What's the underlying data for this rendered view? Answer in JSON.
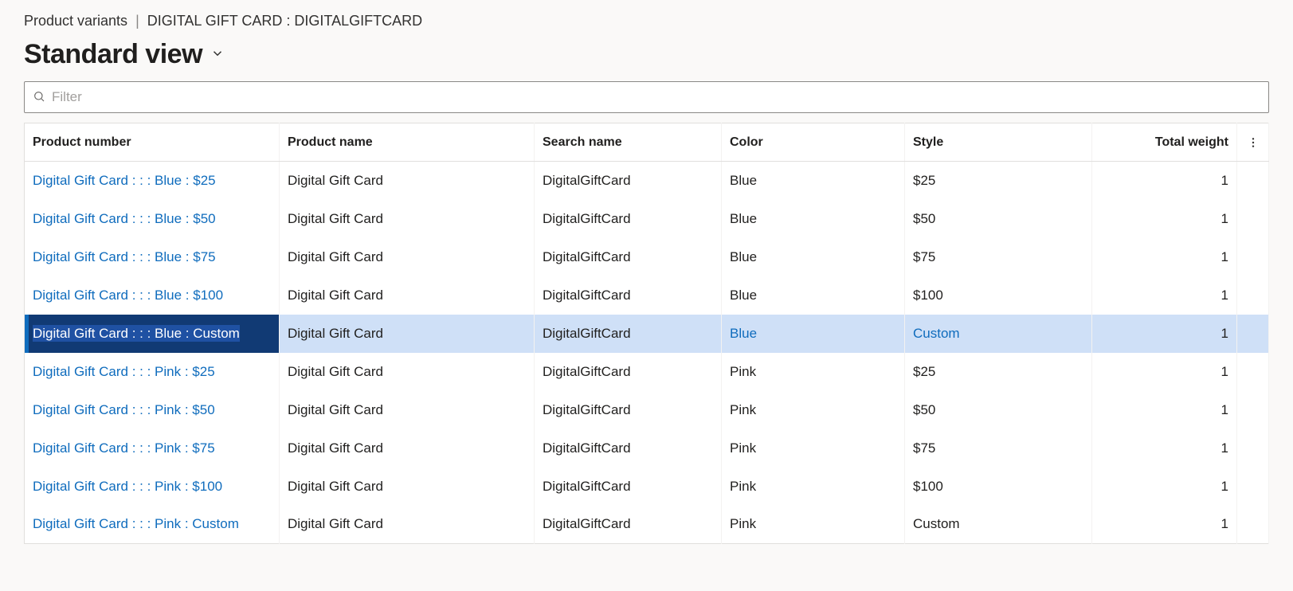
{
  "breadcrumb": {
    "section": "Product variants",
    "detail": "DIGITAL GIFT CARD : DIGITALGIFTCARD"
  },
  "page_title": "Standard view",
  "filter": {
    "placeholder": "Filter"
  },
  "columns": {
    "product_number": "Product number",
    "product_name": "Product name",
    "search_name": "Search name",
    "color": "Color",
    "style": "Style",
    "total_weight": "Total weight"
  },
  "selected_index": 4,
  "rows": [
    {
      "product_number": "Digital Gift Card :  :  : Blue : $25",
      "product_name": "Digital Gift Card",
      "search_name": "DigitalGiftCard",
      "color": "Blue",
      "style": "$25",
      "total_weight": "1"
    },
    {
      "product_number": "Digital Gift Card :  :  : Blue : $50",
      "product_name": "Digital Gift Card",
      "search_name": "DigitalGiftCard",
      "color": "Blue",
      "style": "$50",
      "total_weight": "1"
    },
    {
      "product_number": "Digital Gift Card :  :  : Blue : $75",
      "product_name": "Digital Gift Card",
      "search_name": "DigitalGiftCard",
      "color": "Blue",
      "style": "$75",
      "total_weight": "1"
    },
    {
      "product_number": "Digital Gift Card :  :  : Blue : $100",
      "product_name": "Digital Gift Card",
      "search_name": "DigitalGiftCard",
      "color": "Blue",
      "style": "$100",
      "total_weight": "1"
    },
    {
      "product_number": "Digital Gift Card :  :  : Blue : Custom",
      "product_name": "Digital Gift Card",
      "search_name": "DigitalGiftCard",
      "color": "Blue",
      "style": "Custom",
      "total_weight": "1"
    },
    {
      "product_number": "Digital Gift Card :  :  : Pink : $25",
      "product_name": "Digital Gift Card",
      "search_name": "DigitalGiftCard",
      "color": "Pink",
      "style": "$25",
      "total_weight": "1"
    },
    {
      "product_number": "Digital Gift Card :  :  : Pink : $50",
      "product_name": "Digital Gift Card",
      "search_name": "DigitalGiftCard",
      "color": "Pink",
      "style": "$50",
      "total_weight": "1"
    },
    {
      "product_number": "Digital Gift Card :  :  : Pink : $75",
      "product_name": "Digital Gift Card",
      "search_name": "DigitalGiftCard",
      "color": "Pink",
      "style": "$75",
      "total_weight": "1"
    },
    {
      "product_number": "Digital Gift Card :  :  : Pink : $100",
      "product_name": "Digital Gift Card",
      "search_name": "DigitalGiftCard",
      "color": "Pink",
      "style": "$100",
      "total_weight": "1"
    },
    {
      "product_number": "Digital Gift Card :  :  : Pink : Custom",
      "product_name": "Digital Gift Card",
      "search_name": "DigitalGiftCard",
      "color": "Pink",
      "style": "Custom",
      "total_weight": "1"
    }
  ]
}
